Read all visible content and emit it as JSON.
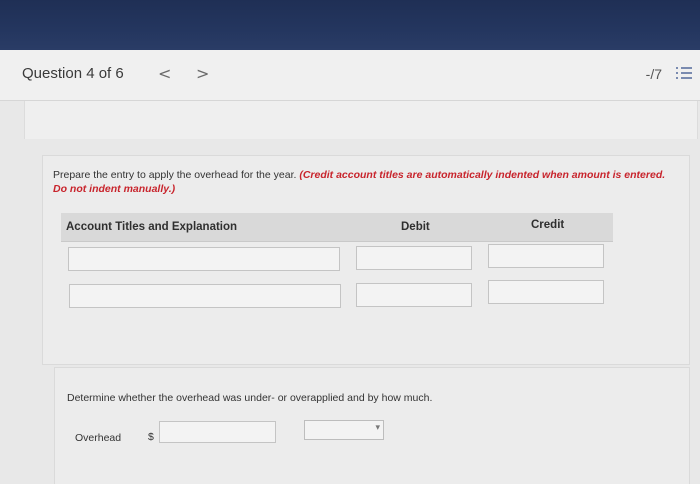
{
  "header": {
    "question_label": "Question 4 of 6",
    "prev_glyph": "<",
    "next_glyph": ">",
    "score": "-/7",
    "menu_icon": "list-icon"
  },
  "part1": {
    "instruction_text": "Prepare the entry to apply the overhead for the year. ",
    "instruction_note": "(Credit account titles are automatically indented when amount is entered. Do not indent manually.)",
    "columns": [
      "Account Titles and Explanation",
      "Debit",
      "Credit"
    ],
    "rows": [
      {
        "account": "",
        "debit": "",
        "credit": ""
      },
      {
        "account": "",
        "debit": "",
        "credit": ""
      }
    ]
  },
  "part2": {
    "question_text": "Determine whether the overhead was under- or overapplied and by how much.",
    "overhead_label": "Overhead",
    "currency_symbol": "$",
    "amount_value": "",
    "status_selected": ""
  }
}
